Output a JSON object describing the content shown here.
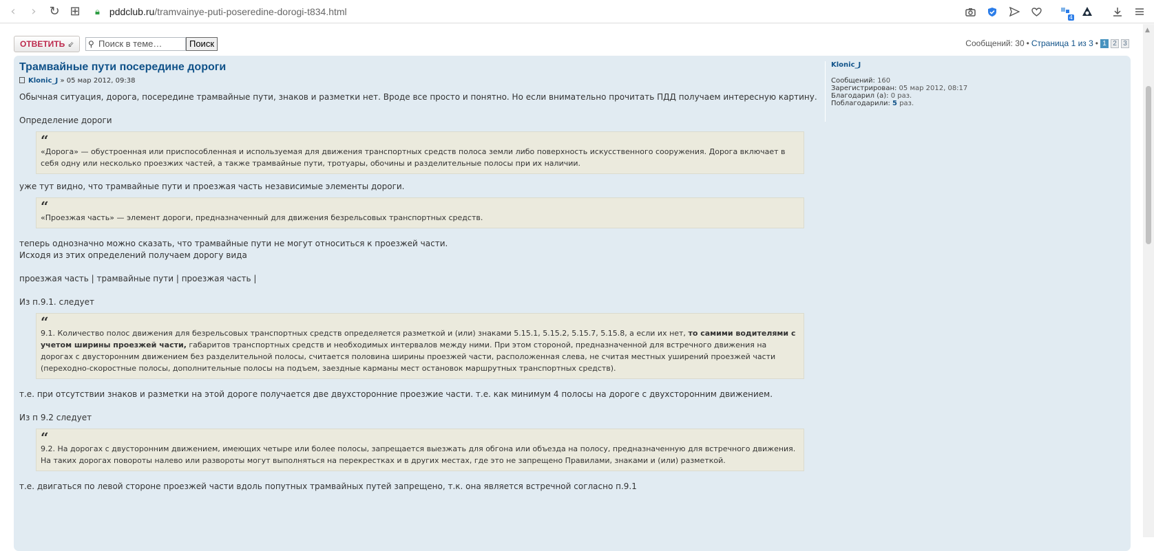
{
  "browser": {
    "url_host": "pddclub.ru",
    "url_path": "/tramvainye-puti-poseredine-dorogi-t834.html",
    "icons": [
      "back-icon",
      "forward-icon",
      "reload-icon",
      "grid-icon",
      "lock-icon",
      "camera-icon",
      "shield-icon",
      "send-icon",
      "heart-icon",
      "extension-icon",
      "alice-icon",
      "download-icon",
      "menu-icon"
    ],
    "extension_badge": "4"
  },
  "topbar": {
    "reply_label": "ОТВЕТИТЬ",
    "search_placeholder": "Поиск в теме…",
    "search_button": "Поиск",
    "messages_count": "Сообщений: 30",
    "bullet": "•",
    "page_info": "Страница 1 из 3",
    "pages": [
      "1",
      "2",
      "3"
    ]
  },
  "post": {
    "title": "Трамвайные пути посередине дороги",
    "author": "Klonic_J",
    "date": "» 05 мар 2012, 09:38",
    "p1": "Обычная ситуация, дорога, посередине трамвайные пути, знаков и разметки нет. Вроде все просто и понятно. Но если внимательно прочитать ПДД получаем интересную картину.",
    "p2": "Определение дороги",
    "q1": "«Дорога» — обустроенная или приспособленная и используемая для движения транспортных средств полоса земли либо поверхность искусственного сооружения. Дорога включает в себя одну или несколько проезжих частей, а также трамвайные пути, тротуары, обочины и разделительные полосы при их наличии.",
    "p3": "уже тут видно, что трамвайные пути и проезжая часть независимые элементы дороги.",
    "q2": "«Проезжая часть» — элемент дороги, предназначенный для движения безрельсовых транспортных средств.",
    "p4": "теперь однозначно можно сказать, что трамвайные пути не могут относиться к проезжей части.",
    "p5": "Исходя из этих определений получаем дорогу вида",
    "p6": "проезжая часть | трамвайные пути | проезжая часть |",
    "p7": "Из п.9.1. следует",
    "q3_a": "9.1. Количество полос движения для безрельсовых транспортных средств определяется разметкой и (или) знаками 5.15.1, 5.15.2, 5.15.7, 5.15.8, а если их нет, ",
    "q3_bold": "то самими водителями с учетом ширины проезжей части,",
    "q3_b": " габаритов транспортных средств и необходимых интервалов между ними. При этом стороной, предназначенной для встречного движения на дорогах с двусторонним движением без разделительной полосы, считается половина ширины проезжей части, расположенная слева, не считая местных уширений проезжей части (переходно-скоростные полосы, дополнительные полосы на подъем, заездные карманы мест остановок маршрутных транспортных средств).",
    "p8": "т.е. при отсутствии знаков и разметки на этой дороге получается две двухсторонние проезжие части. т.е. как минимум 4 полосы на дороге с двухсторонним движением.",
    "p9": "Из п 9.2 следует",
    "q4": "9.2. На дорогах с двусторонним движением, имеющих четыре или более полосы, запрещается выезжать для обгона или объезда на полосу, предназначенную для встречного движения. На таких дорогах повороты налево или развороты могут выполняться на перекрестках и в других местах, где это не запрещено Правилами, знаками и (или) разметкой.",
    "p10": "т.е. двигаться по левой стороне проезжей части вдоль попутных трамвайных путей запрещено, т.к. она является встречной согласно п.9.1"
  },
  "profile": {
    "username": "Klonic_J",
    "messages_label": "Сообщений:",
    "messages_value": "160",
    "registered_label": "Зарегистрирован:",
    "registered_value": "05 мар 2012, 08:17",
    "thanked_label": "Благодарил (а):",
    "thanked_value": "0 раз.",
    "thanks_label": "Поблагодарили:",
    "thanks_value": "5",
    "thanks_suffix": "раз."
  }
}
